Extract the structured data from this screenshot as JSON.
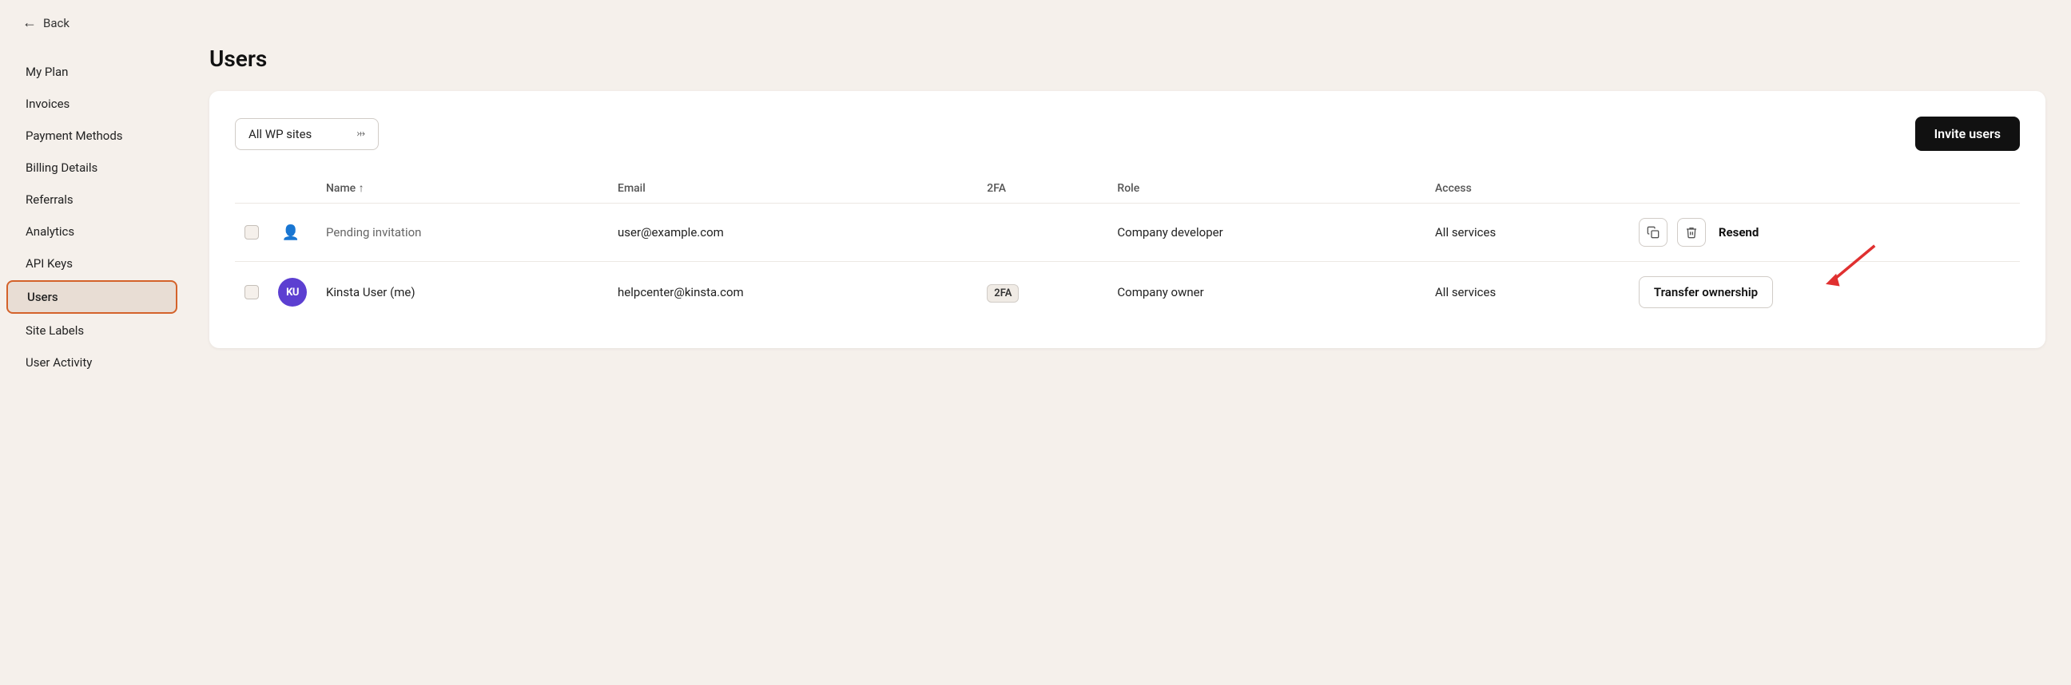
{
  "topbar": {
    "back_label": "Back"
  },
  "sidebar": {
    "items": [
      {
        "id": "my-plan",
        "label": "My Plan",
        "active": false
      },
      {
        "id": "invoices",
        "label": "Invoices",
        "active": false
      },
      {
        "id": "payment-methods",
        "label": "Payment Methods",
        "active": false
      },
      {
        "id": "billing-details",
        "label": "Billing Details",
        "active": false
      },
      {
        "id": "referrals",
        "label": "Referrals",
        "active": false
      },
      {
        "id": "analytics",
        "label": "Analytics",
        "active": false
      },
      {
        "id": "api-keys",
        "label": "API Keys",
        "active": false
      },
      {
        "id": "users",
        "label": "Users",
        "active": true
      },
      {
        "id": "site-labels",
        "label": "Site Labels",
        "active": false
      },
      {
        "id": "user-activity",
        "label": "User Activity",
        "active": false
      }
    ]
  },
  "page": {
    "title": "Users"
  },
  "filter": {
    "selected": "All WP sites",
    "placeholder": "All WP sites"
  },
  "invite_btn": "Invite users",
  "table": {
    "columns": [
      {
        "id": "checkbox",
        "label": ""
      },
      {
        "id": "name",
        "label": "Name ↑"
      },
      {
        "id": "email",
        "label": "Email"
      },
      {
        "id": "twofa",
        "label": "2FA"
      },
      {
        "id": "role",
        "label": "Role"
      },
      {
        "id": "access",
        "label": "Access"
      },
      {
        "id": "actions",
        "label": ""
      }
    ],
    "rows": [
      {
        "id": "row-1",
        "name": "Pending invitation",
        "email": "user@example.com",
        "twofa": "",
        "role": "Company developer",
        "access": "All services",
        "avatar_type": "icon",
        "avatar_text": "",
        "action_type": "resend",
        "action_label": "Resend"
      },
      {
        "id": "row-2",
        "name": "Kinsta User (me)",
        "email": "helpcenter@kinsta.com",
        "twofa": "2FA",
        "role": "Company owner",
        "access": "All services",
        "avatar_type": "circle",
        "avatar_text": "KU",
        "action_type": "transfer",
        "action_label": "Transfer ownership"
      }
    ]
  },
  "icons": {
    "copy": "⧉",
    "trash": "🗑",
    "chevron_down": "⌄"
  }
}
